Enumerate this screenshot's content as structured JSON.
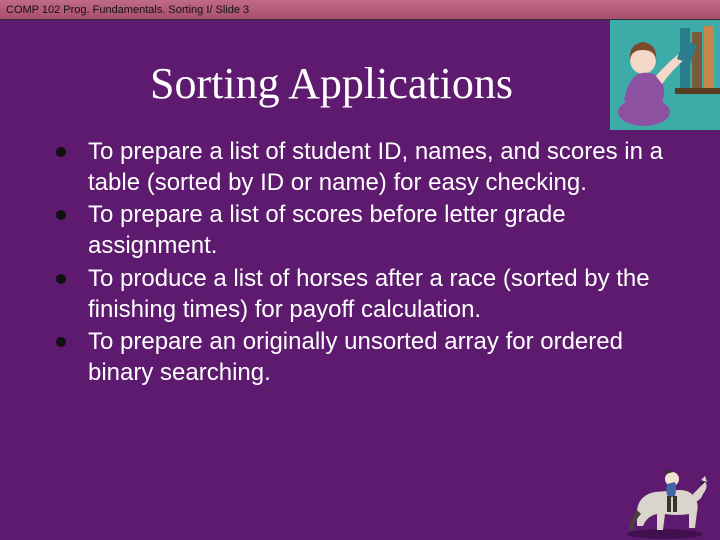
{
  "header": {
    "text": "COMP 102 Prog. Fundamentals. Sorting I/ Slide 3"
  },
  "title": "Sorting Applications",
  "bullets": [
    "To prepare a list of student ID, names, and scores in a table (sorted by ID or name) for easy checking.",
    "To prepare a list of scores before letter grade assignment.",
    "To produce a list of horses after a race (sorted by the finishing times) for payoff calculation.",
    "To prepare an originally unsorted array for ordered binary searching."
  ]
}
